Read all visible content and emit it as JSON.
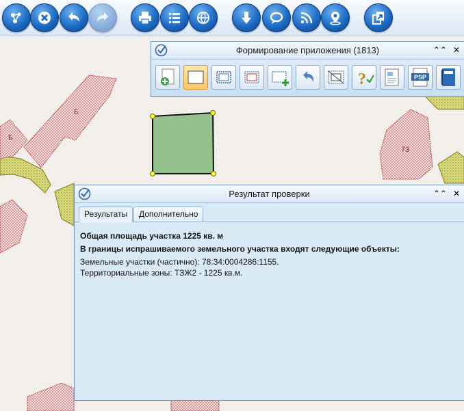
{
  "toolbar": {
    "buttons": [
      {
        "name": "layers-icon",
        "label": "layers"
      },
      {
        "name": "close-icon",
        "label": "close"
      },
      {
        "name": "undo-icon",
        "label": "undo"
      },
      {
        "name": "redo-icon",
        "label": "redo"
      },
      {
        "name": "print-icon",
        "label": "print"
      },
      {
        "name": "list-icon",
        "label": "list"
      },
      {
        "name": "globe-icon",
        "label": "globe"
      },
      {
        "name": "download-icon",
        "label": "download"
      },
      {
        "name": "comment-icon",
        "label": "comment"
      },
      {
        "name": "rss-icon",
        "label": "rss"
      },
      {
        "name": "location-pin-icon",
        "label": "location"
      },
      {
        "name": "export-icon",
        "label": "export"
      }
    ]
  },
  "map": {
    "labels": [
      "Б",
      "Б",
      "73"
    ]
  },
  "form_panel": {
    "title": "Формирование приложения (1813)",
    "collapse_icon": "double-chevron-up-icon",
    "close_icon": "close-x-icon",
    "tools": [
      {
        "name": "add-icon"
      },
      {
        "name": "select-frame-icon"
      },
      {
        "name": "frame-icon"
      },
      {
        "name": "frame-red-icon"
      },
      {
        "name": "frame-add-icon"
      },
      {
        "name": "undo-tool-icon"
      },
      {
        "name": "frame-diagonal-icon"
      },
      {
        "name": "help-icon"
      },
      {
        "name": "document-icon"
      },
      {
        "name": "psp-icon",
        "text": "PSP"
      },
      {
        "name": "notebook-icon"
      }
    ]
  },
  "result_panel": {
    "title": "Результат проверки",
    "tabs": [
      "Результаты",
      "Дополнительно"
    ],
    "area_line": "Общая площадь участка 1225 кв. м",
    "bounds_heading": "В границы испрашиваемого земельного участка входят следующие объекты:",
    "parcels_line": "Земельные участки (частично): 78:34:0004286:1155.",
    "zones_line": "Территориальные зоны: ТЗЖ2 - 1225 кв.м."
  },
  "colors": {
    "toolbar_button": "#1d6cc6",
    "panel_bg": "#d9eaf7",
    "parcel_fill": "#94c28c",
    "building_stroke": "#b22222",
    "zone_fill": "#c8c85a"
  }
}
